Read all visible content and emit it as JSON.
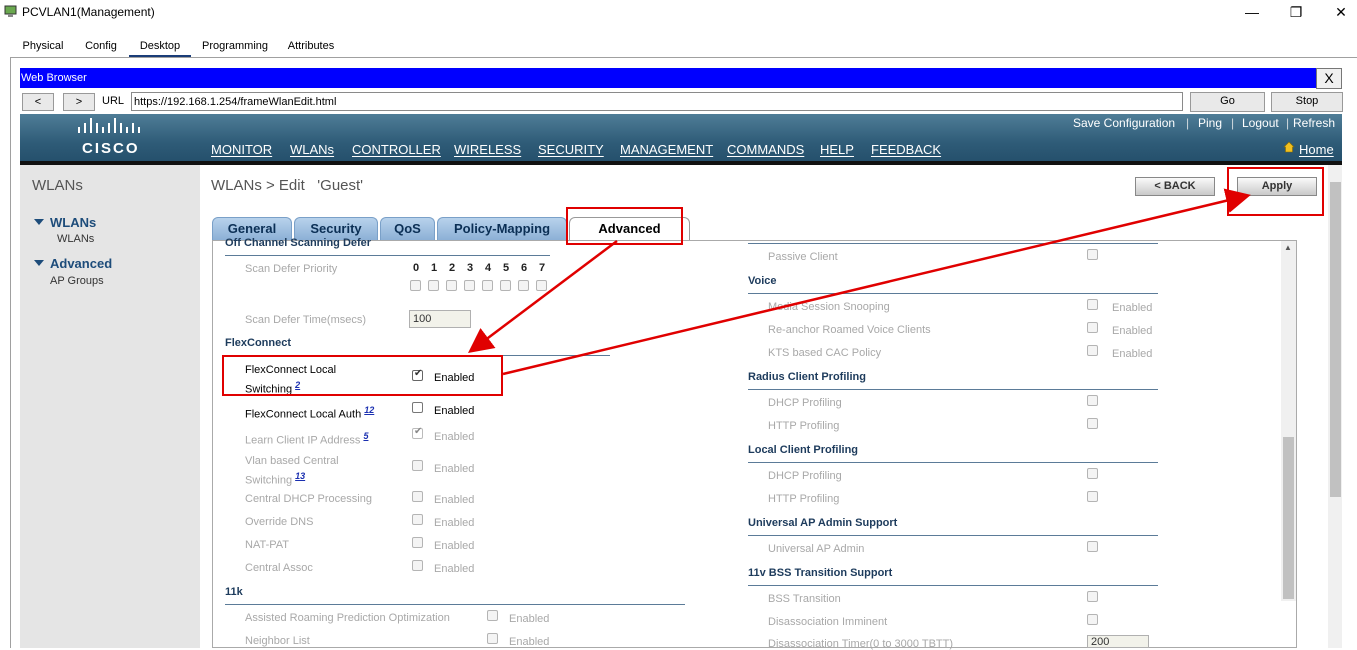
{
  "window": {
    "title": "PCVLAN1(Management)",
    "minimize": "—",
    "restore": "❐",
    "close": "✕"
  },
  "app_tabs": [
    "Physical",
    "Config",
    "Desktop",
    "Programming",
    "Attributes"
  ],
  "browser": {
    "title": "Web Browser",
    "close": "X",
    "back": "<",
    "forward": ">",
    "url_label": "URL",
    "url": "https://192.168.1.254/frameWlanEdit.html",
    "go": "Go",
    "stop": "Stop"
  },
  "header": {
    "logo_text": "CISCO",
    "top_links": [
      "Save Configuration",
      "Ping",
      "Logout",
      "Refresh"
    ],
    "menu": [
      "MONITOR",
      "WLANs",
      "CONTROLLER",
      "WIRELESS",
      "SECURITY",
      "MANAGEMENT",
      "COMMANDS",
      "HELP",
      "FEEDBACK"
    ],
    "home": "Home"
  },
  "sidebar": {
    "heading": "WLANs",
    "items": [
      {
        "label": "WLANs",
        "sub": "WLANs"
      },
      {
        "label": "Advanced",
        "sub": "AP Groups"
      }
    ]
  },
  "page": {
    "title": "WLANs > Edit   'Guest'",
    "back_button": "< BACK",
    "apply_button": "Apply",
    "tabs": [
      "General",
      "Security",
      "QoS",
      "Policy-Mapping",
      "Advanced"
    ]
  },
  "left": {
    "scan_header": "Off Channel Scanning Defer",
    "scan_priority_label": "Scan Defer Priority",
    "scan_priorities": [
      "0",
      "1",
      "2",
      "3",
      "4",
      "5",
      "6",
      "7"
    ],
    "scan_time_label": "Scan Defer Time(msecs)",
    "scan_time_value": "100",
    "flex_header": "FlexConnect",
    "flex_local_switching": "FlexConnect Local Switching",
    "flex_local_switching_sup": "2",
    "flex_local_auth": "FlexConnect Local Auth",
    "flex_local_auth_sup": "12",
    "learn_ip": "Learn Client IP Address",
    "learn_ip_sup": "5",
    "vlan_central": "Vlan based Central Switching",
    "vlan_central_sup": "13",
    "central_dhcp": "Central DHCP Processing",
    "override_dns": "Override DNS",
    "nat_pat": "NAT-PAT",
    "central_assoc": "Central Assoc",
    "enabled": "Enabled",
    "h11k_header": "11k",
    "assisted_roaming": "Assisted Roaming Prediction Optimization",
    "neighbor_list": "Neighbor List"
  },
  "right": {
    "passive_client": "Passive Client",
    "voice_header": "Voice",
    "media_snooping": "Media Session Snooping",
    "reanchor": "Re-anchor Roamed Voice Clients",
    "kts_cac": "KTS based CAC Policy",
    "radius_header": "Radius Client Profiling",
    "dhcp_profiling": "DHCP Profiling",
    "http_profiling": "HTTP Profiling",
    "local_header": "Local Client Profiling",
    "uap_header": "Universal AP Admin Support",
    "uap_admin": "Universal AP Admin",
    "bss_header": "11v BSS Transition Support",
    "bss_transition": "BSS Transition",
    "disassoc_imminent": "Disassociation Imminent",
    "disassoc_timer": "Disassociation Timer(0 to 3000 TBTT)",
    "disassoc_timer_value": "200",
    "enabled": "Enabled"
  },
  "colors": {
    "annotation": "#e00000",
    "browser_bar": "#0000ff",
    "header": "#2f5c78"
  }
}
